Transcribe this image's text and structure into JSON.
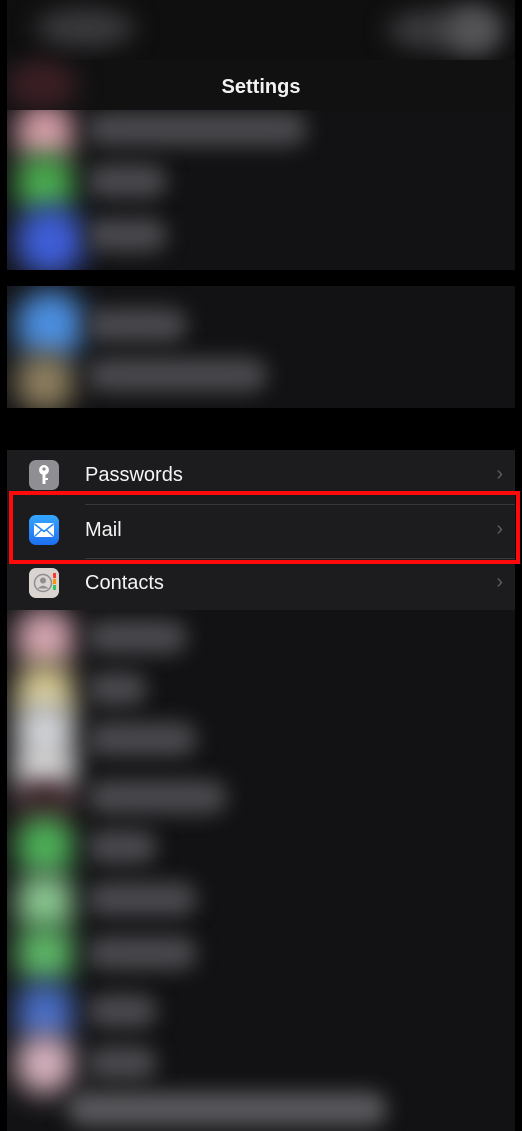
{
  "nav": {
    "title": "Settings"
  },
  "settings_list": {
    "items": [
      {
        "label": "Passwords",
        "icon": "key-icon",
        "chevron": "›"
      },
      {
        "label": "Mail",
        "icon": "mail-icon",
        "chevron": "›"
      },
      {
        "label": "Contacts",
        "icon": "contacts-icon",
        "chevron": "›"
      }
    ]
  },
  "colors": {
    "highlight": "#ff0a0a",
    "mail_icon": "#1e88f5",
    "passwords_icon": "#8e8e93",
    "list_background": "#1c1c1e"
  }
}
